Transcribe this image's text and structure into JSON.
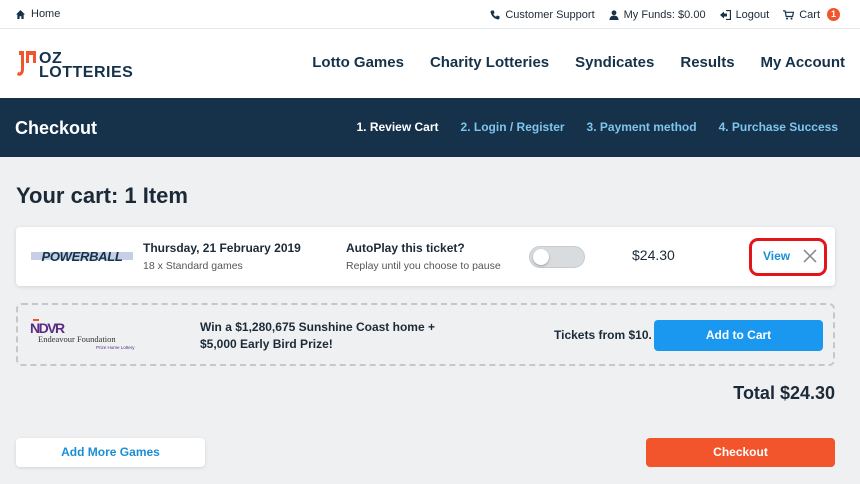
{
  "topbar": {
    "home_label": "Home",
    "support_label": "Customer Support",
    "funds_label": "My Funds: $0.00",
    "logout_label": "Logout",
    "cart_label": "Cart",
    "cart_count": "1"
  },
  "logo": {
    "line1": "OZ",
    "line2": "LOTTERIES"
  },
  "nav": {
    "items": [
      {
        "label": "Lotto Games"
      },
      {
        "label": "Charity Lotteries"
      },
      {
        "label": "Syndicates"
      },
      {
        "label": "Results"
      },
      {
        "label": "My Account"
      }
    ]
  },
  "checkout_bar": {
    "title": "Checkout",
    "steps": [
      {
        "label": "1. Review Cart",
        "active": true
      },
      {
        "label": "2. Login / Register",
        "active": false
      },
      {
        "label": "3. Payment method",
        "active": false
      },
      {
        "label": "4. Purchase Success",
        "active": false
      }
    ]
  },
  "cart": {
    "title": "Your cart: 1 Item",
    "item": {
      "logo_text": "POWERBALL",
      "draw_date": "Thursday, 21 February 2019",
      "games": "18 x Standard games",
      "autoplay_title": "AutoPlay this ticket?",
      "autoplay_sub": "Replay until you choose to pause",
      "autoplay_on": false,
      "price": "$24.30",
      "view_label": "View"
    }
  },
  "promo": {
    "logo_text": "NDVR",
    "org_name": "Endeavour Foundation",
    "org_sub": "Prize Home Lottery",
    "message": "Win a $1,280,675 Sunshine Coast home + $5,000 Early Bird Prize!",
    "tickets_from": "Tickets from $10.",
    "add_label": "Add to Cart"
  },
  "total_label": "Total $24.30",
  "actions": {
    "add_more_label": "Add More Games",
    "checkout_label": "Checkout"
  },
  "colors": {
    "navy": "#15324a",
    "accent_blue": "#1a98f0",
    "orange": "#f2552c",
    "highlight_red": "#e3151a"
  }
}
